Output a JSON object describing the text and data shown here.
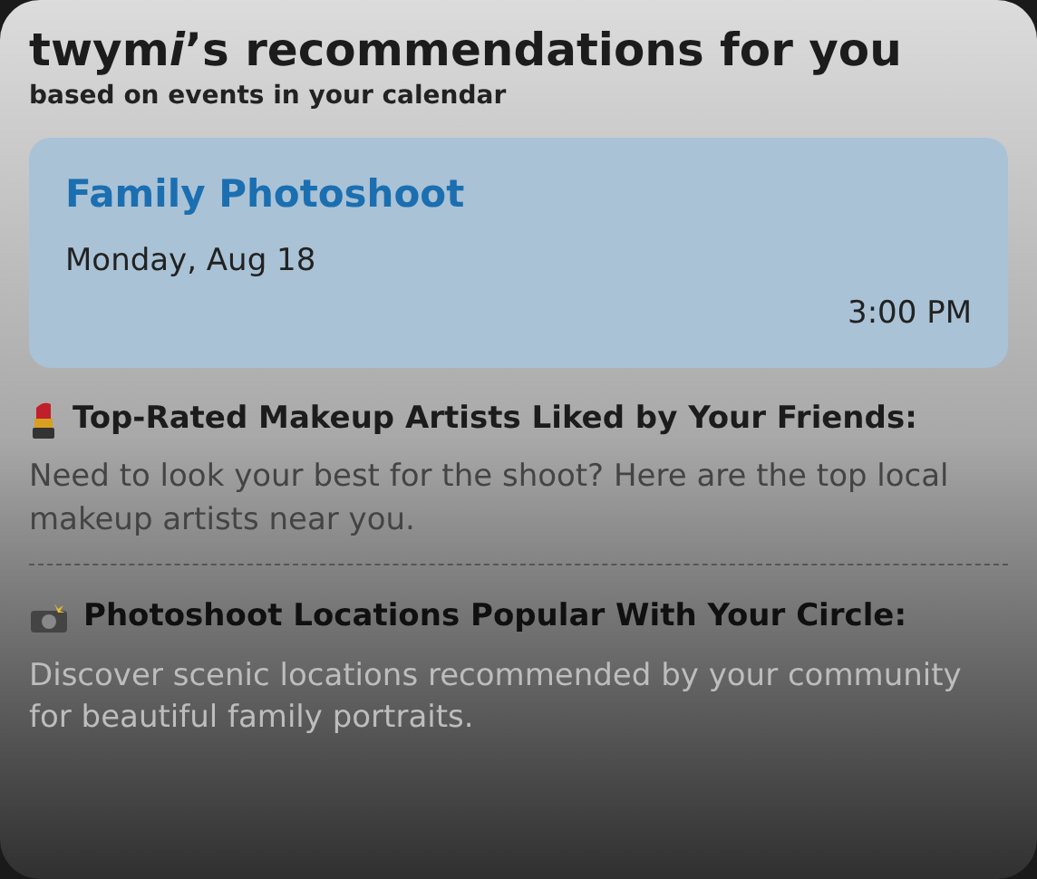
{
  "header": {
    "title": [
      {
        "text": "twym",
        "italic": false
      },
      {
        "text": "i",
        "italic": true
      },
      {
        "text": "’s recommendations for you",
        "italic": false
      }
    ],
    "subtitle": "based on events in your calendar"
  },
  "event": {
    "title": "Family Photoshoot",
    "date": "Monday, Aug 18",
    "time": "3:00 PM"
  },
  "recommendations": [
    {
      "kind": "lipstick",
      "title": "Top-Rated Makeup Artists Liked by Your Friends:",
      "description": "Need to look your best for the shoot? Here are the top local makeup artists near you."
    },
    {
      "kind": "camera",
      "title": "Photoshoot Locations Popular With Your Circle:",
      "description": "Discover scenic locations recommended by your community for beautiful family portraits."
    }
  ]
}
